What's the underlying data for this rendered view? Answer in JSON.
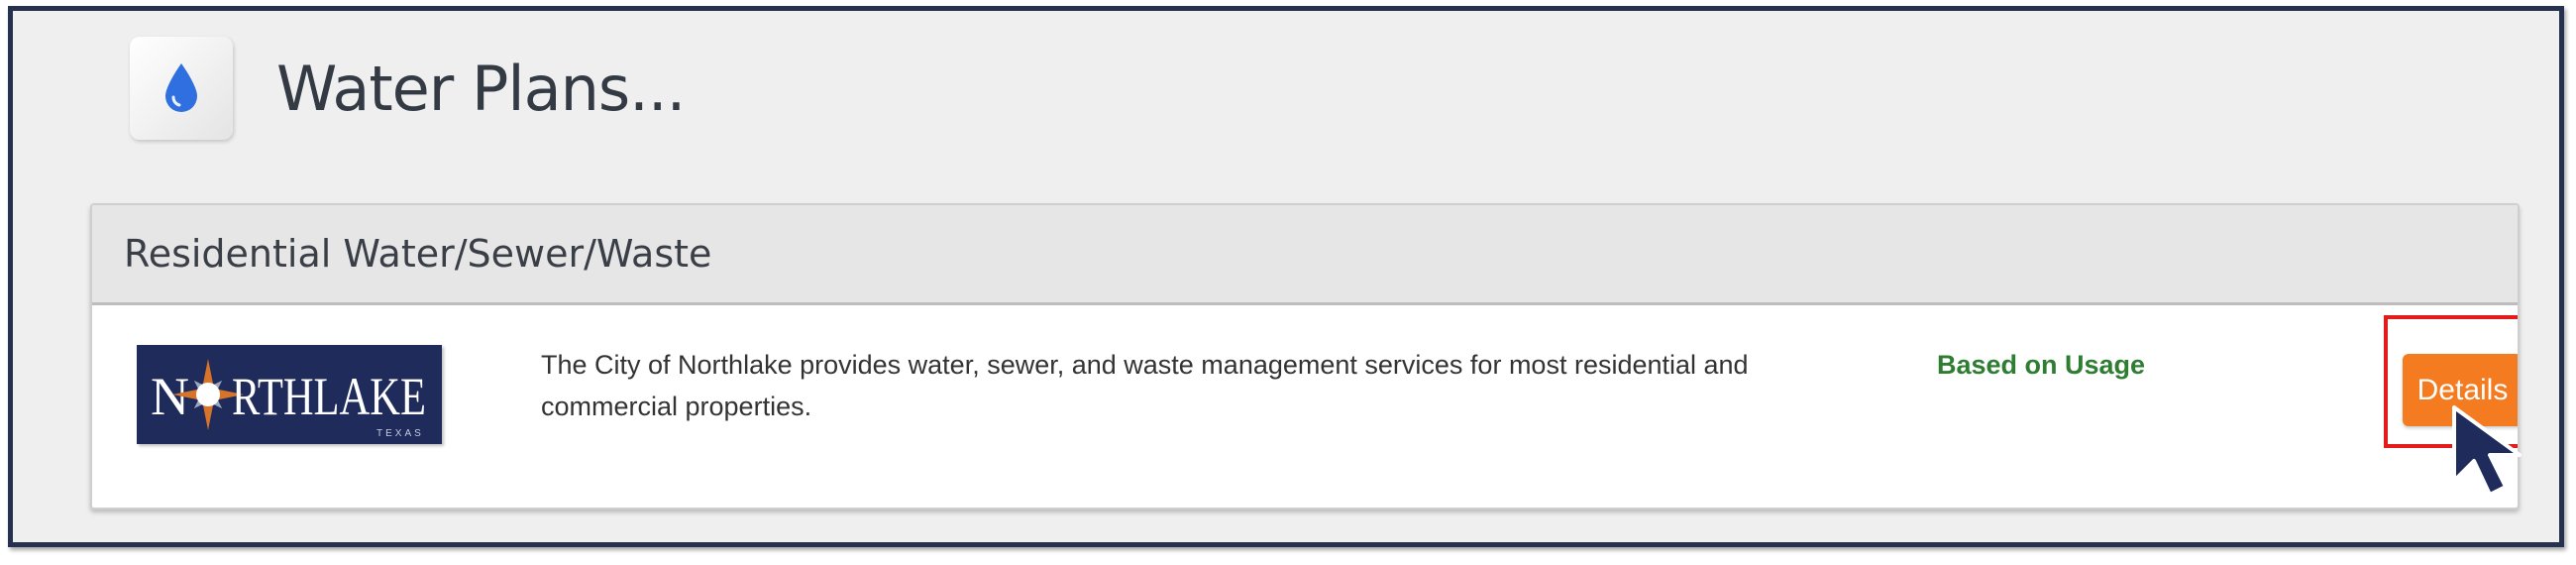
{
  "page": {
    "title": "Water Plans...",
    "icon": "water-drop-icon"
  },
  "plan_group": {
    "title": "Residential Water/Sewer/Waste",
    "plans": [
      {
        "provider_logo": "northlake-logo",
        "provider_logo_text": "NORTHLAKE",
        "provider_logo_subtext": "TEXAS",
        "description": "The City of Northlake provides water, sewer, and waste management services for most residential and commercial properties.",
        "pricing": "Based on Usage",
        "details_label": "Details"
      }
    ]
  },
  "colors": {
    "accent": "#f47b20",
    "pricing_text": "#2e7d32",
    "highlight_border": "#e31b1b",
    "frame_border": "#26324d",
    "water_drop": "#2f6fe0"
  }
}
